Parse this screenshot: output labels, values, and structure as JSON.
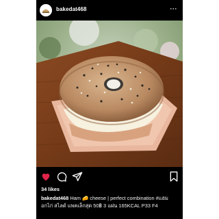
{
  "post": {
    "username": "bakedat468",
    "more_label": "···",
    "likes": "34 likes",
    "caption": {
      "author": "bakedat468",
      "segment1": "Ham",
      "emoji": "🧀",
      "segment2": "cheese | perfect combination #แฮมอกไก่ สไลด์ แพคเล็กสุด  50฿ 3 แผ่น 165KCAL P33 F4"
    }
  },
  "colors": {
    "background": "#000000",
    "text": "#ffffff",
    "like_heart": "#e0244a"
  },
  "icons": [
    "heart-icon",
    "comment-icon",
    "share-icon",
    "bookmark-icon",
    "more-icon"
  ]
}
